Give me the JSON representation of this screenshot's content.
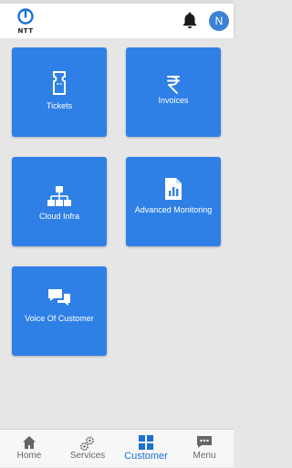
{
  "header": {
    "logo_text": "NTT",
    "avatar_initial": "N"
  },
  "tiles": [
    {
      "label": "Tickets",
      "icon": "ticket-icon"
    },
    {
      "label": "Invoices",
      "icon": "rupee-icon"
    },
    {
      "label": "Cloud Infra",
      "icon": "hierarchy-icon"
    },
    {
      "label": "Advanced Monitoring",
      "icon": "report-chart-icon"
    },
    {
      "label": "Voice Of Customer",
      "icon": "chat-bubbles-icon"
    }
  ],
  "bottom_nav": {
    "items": [
      {
        "label": "Home",
        "icon": "home-icon",
        "active": false
      },
      {
        "label": "Services",
        "icon": "gears-icon",
        "active": false
      },
      {
        "label": "Customer",
        "icon": "grid-icon",
        "active": true
      },
      {
        "label": "Menu",
        "icon": "chat-menu-icon",
        "active": false
      }
    ]
  },
  "colors": {
    "tile_blue": "#2f80e6",
    "avatar_blue": "#3b82d6",
    "active_nav": "#1e6fd0",
    "background": "#e6e6e6"
  }
}
